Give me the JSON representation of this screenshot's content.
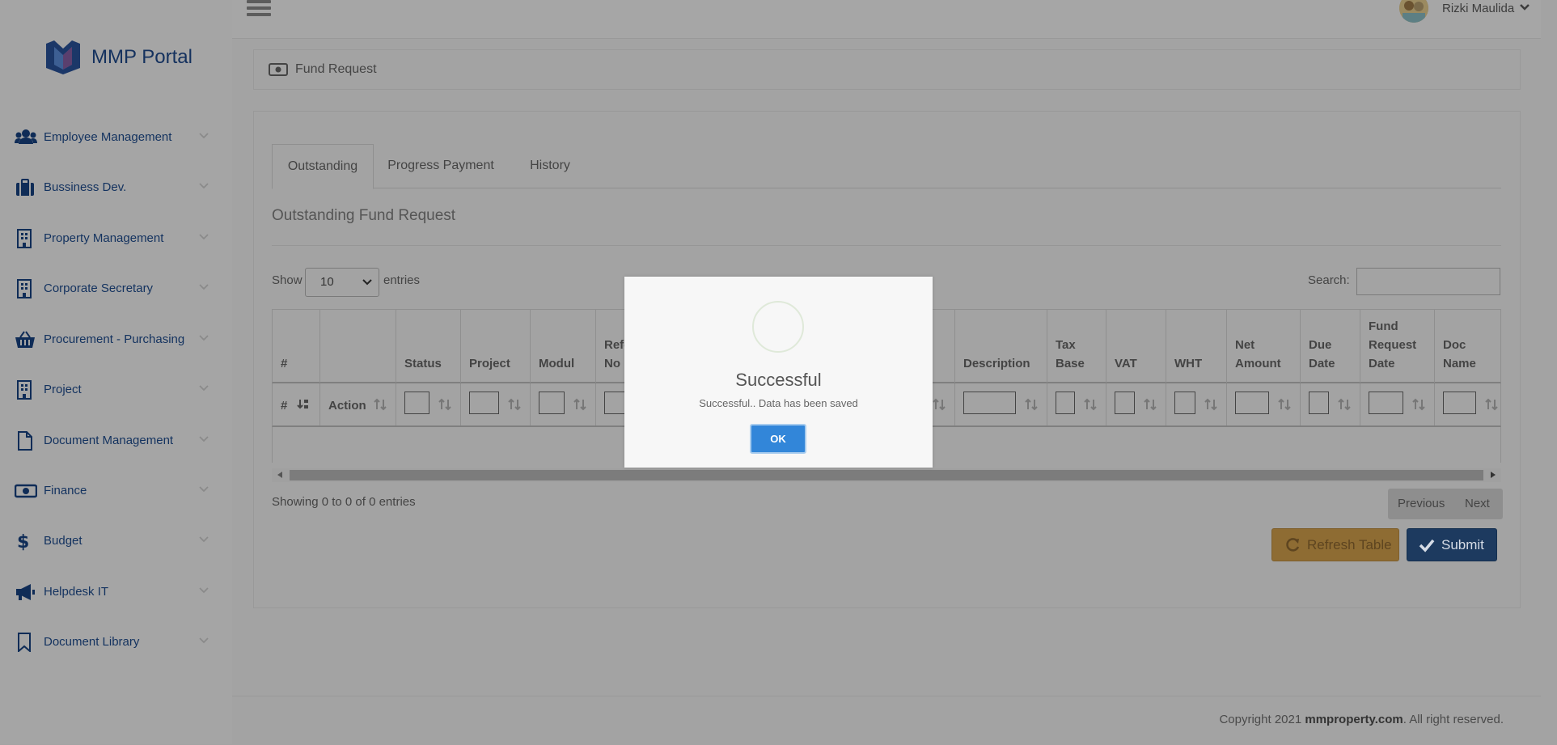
{
  "brand": {
    "name": "MMP Portal"
  },
  "sidebar": {
    "items": [
      {
        "label": "Employee Management",
        "icon": "users-icon"
      },
      {
        "label": "Bussiness Dev.",
        "icon": "briefcase-icon"
      },
      {
        "label": "Property Management",
        "icon": "building-icon"
      },
      {
        "label": "Corporate Secretary",
        "icon": "building-icon"
      },
      {
        "label": "Procurement - Purchasing",
        "icon": "basket-icon"
      },
      {
        "label": "Project",
        "icon": "building-icon"
      },
      {
        "label": "Document Management",
        "icon": "file-icon"
      },
      {
        "label": "Finance",
        "icon": "money-icon"
      },
      {
        "label": "Budget",
        "icon": "dollar-icon"
      },
      {
        "label": "Helpdesk IT",
        "icon": "megaphone-icon"
      },
      {
        "label": "Document Library",
        "icon": "bookmark-icon"
      }
    ]
  },
  "header": {
    "user_name": "Rizki Maulida"
  },
  "breadcrumb": {
    "title": "Fund Request"
  },
  "tabs": [
    {
      "label": "Outstanding",
      "active": true
    },
    {
      "label": "Progress Payment",
      "active": false
    },
    {
      "label": "History",
      "active": false
    }
  ],
  "section": {
    "title": "Outstanding Fund Request"
  },
  "table_controls": {
    "show_label": "Show",
    "page_size": "10",
    "entries_label": "entries",
    "search_label": "Search:"
  },
  "table": {
    "columns": [
      "#",
      "Action",
      "Status",
      "Project",
      "Modul",
      "Refe\nNo",
      "",
      "Description",
      "Tax\nBase",
      "VAT",
      "WHT",
      "Net\nAmount",
      "Due\nDate",
      "Fund\nRequest\nDate",
      "Doc\nName"
    ],
    "rows": []
  },
  "pagination": {
    "info": "Showing 0 to 0 of 0 entries",
    "previous": "Previous",
    "next": "Next"
  },
  "actions": {
    "refresh_label": "Refresh Table",
    "submit_label": "Submit"
  },
  "footer": {
    "prefix": "Copyright 2021 ",
    "site": "mmproperty.com",
    "suffix": ". All right reserved."
  },
  "modal": {
    "title": "Successful",
    "message": "Successful.. Data has been saved",
    "ok_label": "OK"
  },
  "colors": {
    "overlay_bg": "#a3a3a3",
    "sidebar_text": "#13325f",
    "ok_button": "#3286d9",
    "refresh_button": "#8e6c33",
    "submit_button": "#1d3a5f"
  }
}
